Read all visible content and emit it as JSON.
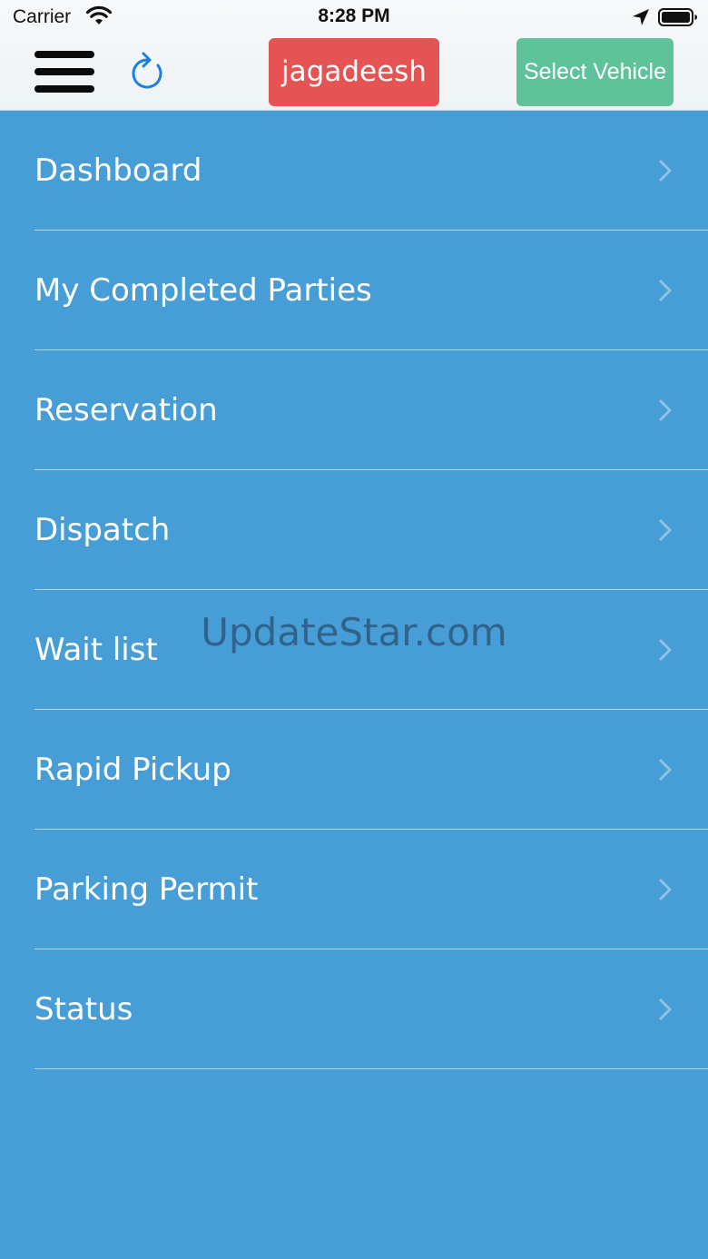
{
  "status_bar": {
    "carrier": "Carrier",
    "time": "8:28 PM",
    "wifi_icon": "wifi-icon",
    "location_icon": "location-arrow-icon",
    "battery_icon": "battery-icon"
  },
  "nav": {
    "menu_icon": "hamburger-menu-icon",
    "refresh_icon": "refresh-icon",
    "user_label": "jagadeesh",
    "vehicle_label": "Select Vehicle"
  },
  "menu": {
    "items": [
      {
        "label": "Dashboard"
      },
      {
        "label": "My Completed Parties"
      },
      {
        "label": "Reservation"
      },
      {
        "label": "Dispatch"
      },
      {
        "label": "Wait list"
      },
      {
        "label": "Rapid Pickup"
      },
      {
        "label": "Parking Permit"
      },
      {
        "label": "Status"
      }
    ],
    "chevron_icon": "chevron-right-icon"
  },
  "watermark": "UpdateStar.com",
  "colors": {
    "background": "#479ed7",
    "user_button": "#e55353",
    "vehicle_button": "#5ec29a",
    "refresh_icon": "#1a7fe0"
  }
}
